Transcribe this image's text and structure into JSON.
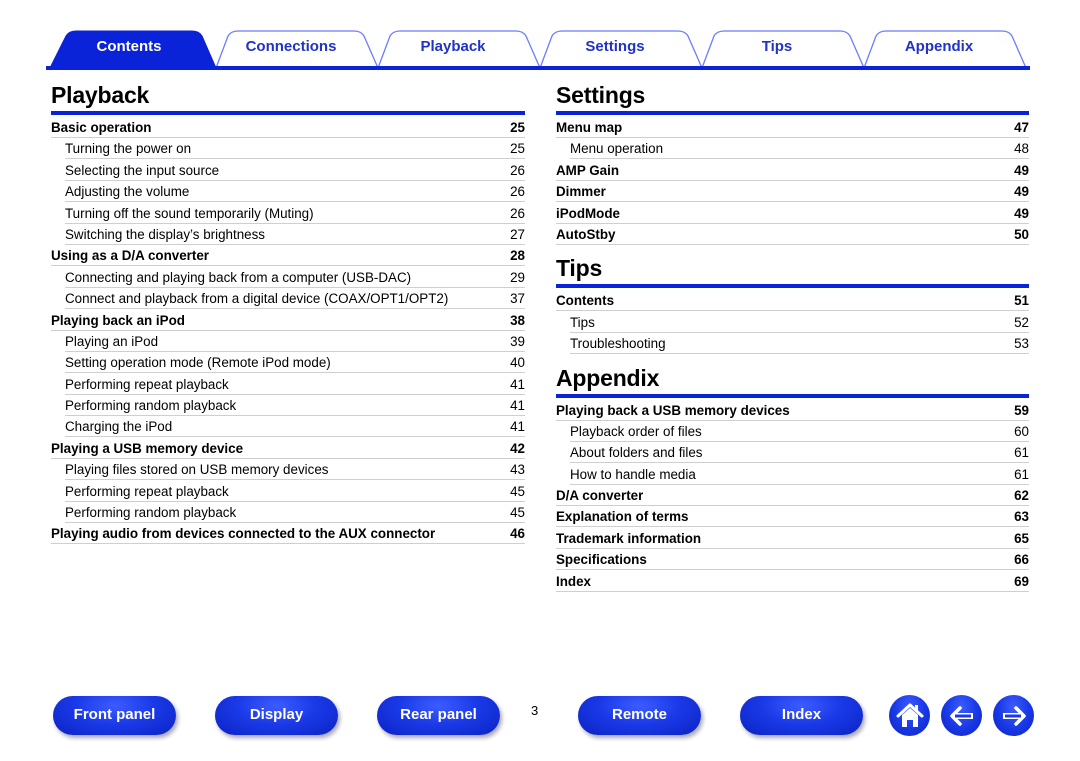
{
  "tabs": [
    {
      "label": "Contents",
      "active": true
    },
    {
      "label": "Connections",
      "active": false
    },
    {
      "label": "Playback",
      "active": false
    },
    {
      "label": "Settings",
      "active": false
    },
    {
      "label": "Tips",
      "active": false
    },
    {
      "label": "Appendix",
      "active": false
    }
  ],
  "colors": {
    "accent": "#0a22d8",
    "tab_text": "#2033c4",
    "tab_border": "#6b7bff"
  },
  "playback": {
    "title": "Playback",
    "rows": [
      {
        "label": "Basic operation",
        "page": "25",
        "level": "main"
      },
      {
        "label": "Turning the power on",
        "page": "25",
        "level": "sub"
      },
      {
        "label": "Selecting the input source",
        "page": "26",
        "level": "sub"
      },
      {
        "label": "Adjusting the volume",
        "page": "26",
        "level": "sub"
      },
      {
        "label": "Turning off the sound temporarily (Muting)",
        "page": "26",
        "level": "sub"
      },
      {
        "label": "Switching the display’s brightness",
        "page": "27",
        "level": "sub"
      },
      {
        "label": "Using as a D/A converter",
        "page": "28",
        "level": "main"
      },
      {
        "label": "Connecting and playing back from a computer (USB-DAC)",
        "page": "29",
        "level": "sub"
      },
      {
        "label": "Connect and playback from a digital device (COAX/OPT1/OPT2)",
        "page": "37",
        "level": "sub"
      },
      {
        "label": "Playing back an iPod",
        "page": "38",
        "level": "main"
      },
      {
        "label": "Playing an iPod",
        "page": "39",
        "level": "sub"
      },
      {
        "label": "Setting operation mode (Remote iPod mode)",
        "page": "40",
        "level": "sub"
      },
      {
        "label": "Performing repeat playback",
        "page": "41",
        "level": "sub"
      },
      {
        "label": "Performing random playback",
        "page": "41",
        "level": "sub"
      },
      {
        "label": "Charging the iPod",
        "page": "41",
        "level": "sub"
      },
      {
        "label": "Playing a USB memory device",
        "page": "42",
        "level": "main"
      },
      {
        "label": "Playing files stored on USB memory devices",
        "page": "43",
        "level": "sub"
      },
      {
        "label": "Performing repeat playback",
        "page": "45",
        "level": "sub"
      },
      {
        "label": "Performing random playback",
        "page": "45",
        "level": "sub"
      },
      {
        "label": "Playing audio from devices connected to the AUX connector",
        "page": "46",
        "level": "main"
      }
    ]
  },
  "settings": {
    "title": "Settings",
    "rows": [
      {
        "label": "Menu map",
        "page": "47",
        "level": "main"
      },
      {
        "label": "Menu operation",
        "page": "48",
        "level": "sub"
      },
      {
        "label": "AMP Gain",
        "page": "49",
        "level": "main"
      },
      {
        "label": "Dimmer",
        "page": "49",
        "level": "main"
      },
      {
        "label": "iPodMode",
        "page": "49",
        "level": "main"
      },
      {
        "label": "AutoStby",
        "page": "50",
        "level": "main"
      }
    ]
  },
  "tips": {
    "title": "Tips",
    "rows": [
      {
        "label": "Contents",
        "page": "51",
        "level": "main"
      },
      {
        "label": "Tips",
        "page": "52",
        "level": "sub"
      },
      {
        "label": "Troubleshooting",
        "page": "53",
        "level": "sub"
      }
    ]
  },
  "appendix": {
    "title": "Appendix",
    "rows": [
      {
        "label": "Playing back a USB memory devices",
        "page": "59",
        "level": "main"
      },
      {
        "label": "Playback order of files",
        "page": "60",
        "level": "sub"
      },
      {
        "label": "About folders and files",
        "page": "61",
        "level": "sub"
      },
      {
        "label": "How to handle media",
        "page": "61",
        "level": "sub"
      },
      {
        "label": "D/A converter",
        "page": "62",
        "level": "main"
      },
      {
        "label": "Explanation of terms",
        "page": "63",
        "level": "main"
      },
      {
        "label": "Trademark information",
        "page": "65",
        "level": "main"
      },
      {
        "label": "Specifications",
        "page": "66",
        "level": "main"
      },
      {
        "label": "Index",
        "page": "69",
        "level": "main"
      }
    ]
  },
  "footer": {
    "buttons": [
      "Front panel",
      "Display",
      "Rear panel",
      "Remote",
      "Index"
    ],
    "page_number": "3",
    "icons": [
      "home-icon",
      "arrow-left-icon",
      "arrow-right-icon"
    ]
  }
}
